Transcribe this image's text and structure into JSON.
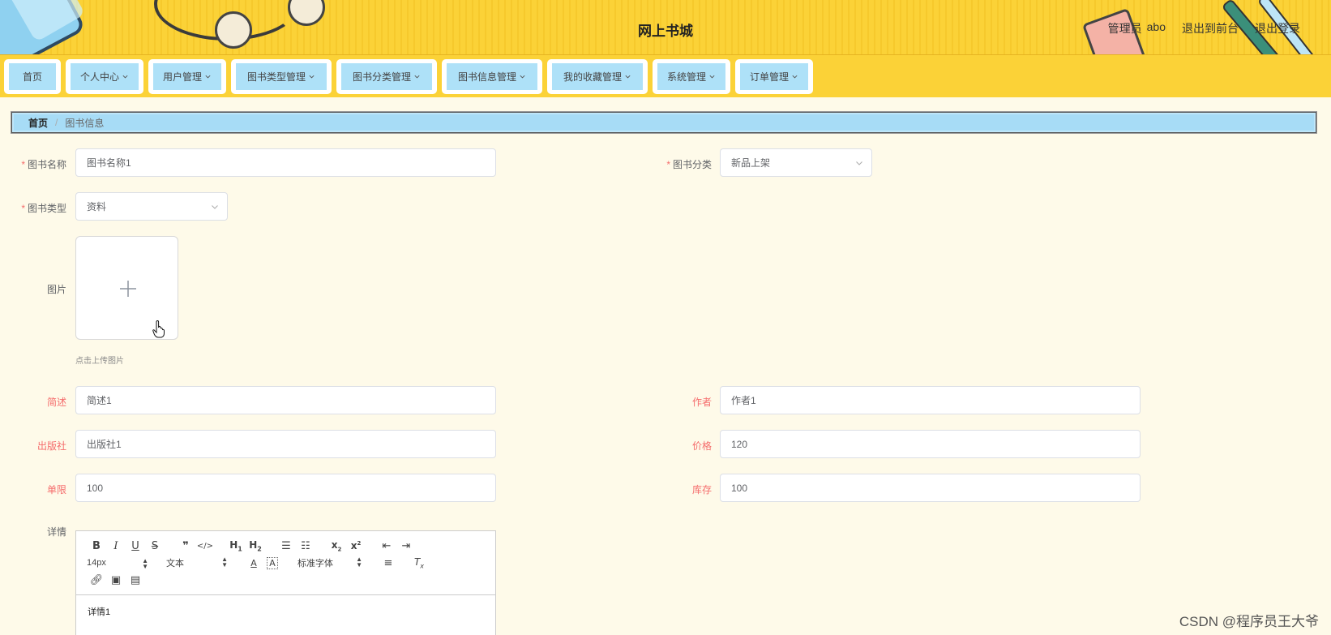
{
  "header": {
    "title": "网上书城",
    "admin_role": "管理员",
    "admin_name": "abo",
    "to_frontend": "退出到前台",
    "logout": "退出登录"
  },
  "nav": {
    "items": [
      {
        "label": "首页",
        "has_dropdown": false
      },
      {
        "label": "个人中心",
        "has_dropdown": true
      },
      {
        "label": "用户管理",
        "has_dropdown": true
      },
      {
        "label": "图书类型管理",
        "has_dropdown": true
      },
      {
        "label": "图书分类管理",
        "has_dropdown": true
      },
      {
        "label": "图书信息管理",
        "has_dropdown": true
      },
      {
        "label": "我的收藏管理",
        "has_dropdown": true
      },
      {
        "label": "系统管理",
        "has_dropdown": true
      },
      {
        "label": "订单管理",
        "has_dropdown": true
      }
    ]
  },
  "breadcrumb": {
    "home": "首页",
    "separator": "/",
    "current": "图书信息"
  },
  "form": {
    "book_name": {
      "label": "图书名称",
      "required": true,
      "value": "图书名称1"
    },
    "book_category": {
      "label": "图书分类",
      "required": true,
      "value": "新品上架"
    },
    "book_type": {
      "label": "图书类型",
      "required": true,
      "value": "资料"
    },
    "image": {
      "label": "图片",
      "tip": "点击上传图片"
    },
    "summary": {
      "label": "简述",
      "value": "简述1"
    },
    "author": {
      "label": "作者",
      "value": "作者1"
    },
    "publisher": {
      "label": "出版社",
      "value": "出版社1"
    },
    "price": {
      "label": "价格",
      "value": "120"
    },
    "limit": {
      "label": "单限",
      "value": "100"
    },
    "stock": {
      "label": "库存",
      "value": "100"
    },
    "detail": {
      "label": "详情",
      "font_size": "14px",
      "block_format": "文本",
      "font_family": "标准字体",
      "content": "详情1"
    }
  },
  "watermark": "CSDN @程序员王大爷",
  "colors": {
    "header_yellow": "#fbd237",
    "nav_item_bg": "#aee1f8",
    "page_bg": "#fefae9",
    "required_red": "#f56c6c"
  }
}
